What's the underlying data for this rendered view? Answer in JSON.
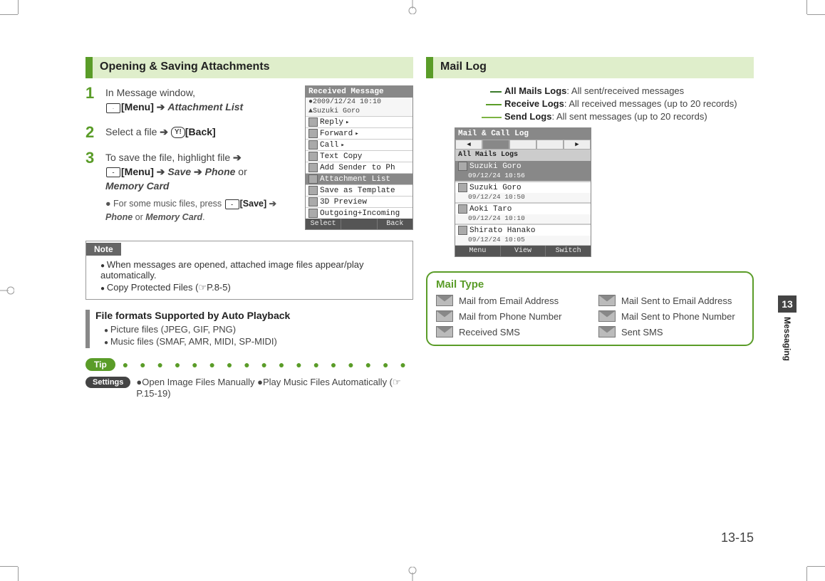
{
  "left": {
    "title": "Opening & Saving Attachments",
    "step1_num": "1",
    "step1_a": "In Message window,",
    "step1_menu": "[Menu]",
    "step1_arrow": "➔",
    "step1_item": "Attachment List",
    "step2_num": "2",
    "step2_a": "Select a file",
    "step2_back": "[Back]",
    "step3_num": "3",
    "step3_a": "To save the file, highlight file",
    "step3_menu": "[Menu]",
    "step3_save": "Save",
    "step3_phone": "Phone",
    "step3_or": " or ",
    "step3_mc": "Memory Card",
    "step3_sub": "For some music files, press ",
    "step3_sub_save": "[Save]",
    "step3_sub_phone": "Phone",
    "step3_sub_or": " or ",
    "step3_sub_mc": "Memory Card",
    "step3_sub_period": ".",
    "phone1": {
      "title": "Received Message",
      "meta1": "●2009/12/24 10:10",
      "meta2": "▲Suzuki Goro",
      "rows": [
        "Reply",
        "Forward",
        "Call",
        "Text Copy",
        "Add Sender to Ph",
        "Attachment List",
        "Save as Template",
        "3D Preview",
        "Outgoing+Incoming"
      ],
      "sel_index": 5,
      "soft": [
        "Select",
        "",
        "Back"
      ]
    },
    "note_label": "Note",
    "note_items": [
      "When messages are opened, attached image files appear/play automatically.",
      "Copy Protected Files (☞P.8-5)"
    ],
    "ff_title": "File formats Supported by Auto Playback",
    "ff_items": [
      "Picture files (JPEG, GIF, PNG)",
      "Music files (SMAF, AMR, MIDI, SP-MIDI)"
    ],
    "tip": "Tip",
    "settings_label": "Settings",
    "settings_text": "●Open Image Files Manually ●Play Music Files Automatically (☞P.15-19)"
  },
  "right": {
    "title": "Mail Log",
    "legend": [
      {
        "b": "All Mails Logs",
        "t": ": All sent/received messages"
      },
      {
        "b": "Receive Logs",
        "t": ": All received messages (up to 20 records)"
      },
      {
        "b": "Send Logs",
        "t": ": All sent messages (up to 20 records)"
      }
    ],
    "phone": {
      "title": "Mail & Call Log",
      "tabs": [
        "◀",
        "",
        "",
        "",
        "▶"
      ],
      "tabbar": "All Mails Logs",
      "rows": [
        {
          "n": "Suzuki Goro",
          "t": "09/12/24 10:56",
          "sel": true
        },
        {
          "n": "Suzuki Goro",
          "t": "09/12/24 10:50",
          "sel": false
        },
        {
          "n": "Aoki Taro",
          "t": "09/12/24 10:10",
          "sel": false
        },
        {
          "n": "Shirato Hanako",
          "t": "09/12/24 10:05",
          "sel": false
        }
      ],
      "soft": [
        "Menu",
        "View",
        "Switch"
      ]
    },
    "mailtype_title": "Mail Type",
    "mailtype_items_left": [
      "Mail from Email Address",
      "Mail from Phone Number",
      "Received SMS"
    ],
    "mailtype_items_right": [
      "Mail Sent to Email Address",
      "Mail Sent to Phone Number",
      "Sent SMS"
    ]
  },
  "sidebar": {
    "num": "13",
    "label": "Messaging"
  },
  "footer": "13-15"
}
